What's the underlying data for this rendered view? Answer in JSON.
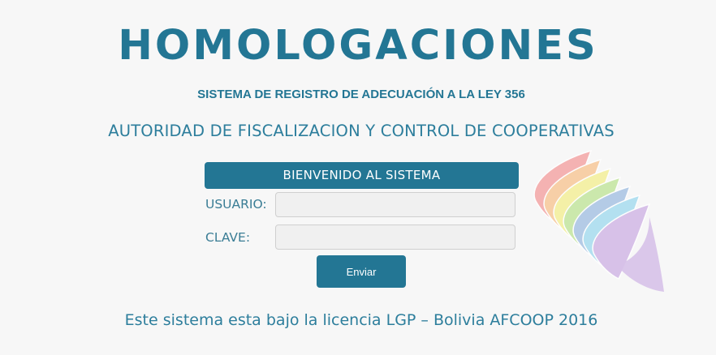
{
  "header": {
    "title": "HOMOLOGACIONES",
    "subtitle": "SISTEMA DE REGISTRO DE ADECUACIÓN A LA LEY 356",
    "organization": "AUTORIDAD DE FISCALIZACION Y CONTROL DE COOPERATIVAS"
  },
  "login": {
    "welcome": "BIENVENIDO AL SISTEMA",
    "user_label": "USUARIO:",
    "user_value": "",
    "password_label": "CLAVE:",
    "password_value": "",
    "submit_label": "Enviar"
  },
  "footer": {
    "text": "Este sistema esta bajo la licencia LGP – Bolivia AFCOOP 2016"
  },
  "colors": {
    "primary": "#237694",
    "background": "#f7f7f7",
    "input_bg": "#f0f0f0",
    "rainbow": [
      "#f4a6a6",
      "#f8c99a",
      "#f4ef9a",
      "#c4e6a0",
      "#a9c4e4",
      "#a8dcef",
      "#d2b8e6"
    ]
  },
  "logo": {
    "icon": "wiphala-rainbow-logo-icon"
  }
}
